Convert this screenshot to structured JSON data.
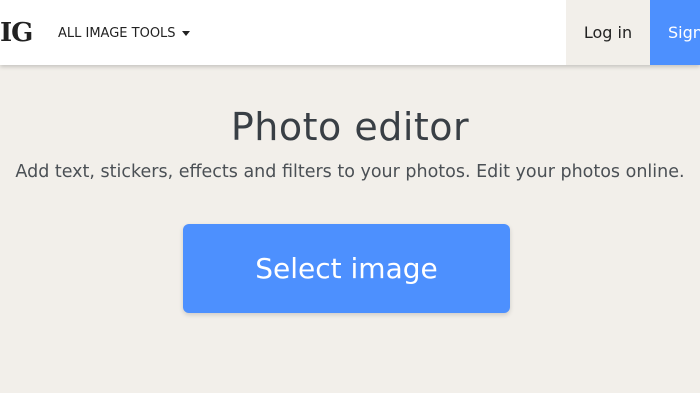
{
  "header": {
    "logo_text": "IG",
    "tools_menu_label": "ALL IMAGE TOOLS",
    "login_label": "Log in",
    "signup_label": "Sign"
  },
  "main": {
    "title": "Photo editor",
    "subtitle": "Add text, stickers, effects and filters to your photos. Edit your photos online.",
    "select_button_label": "Select image"
  },
  "colors": {
    "accent": "#4d90fe",
    "background": "#f2efea",
    "header_bg": "#ffffff",
    "text_dark": "#393f45"
  },
  "icons": {
    "tools_menu_caret": "caret-down-icon"
  }
}
